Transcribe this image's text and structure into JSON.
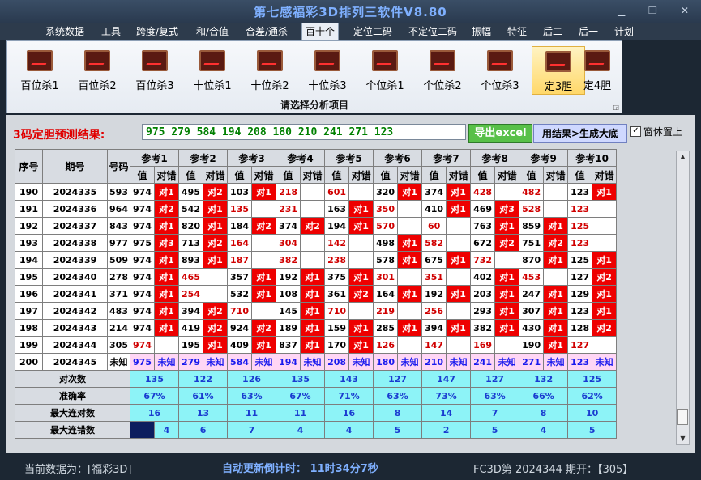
{
  "app": {
    "title": "第七感福彩3D排列三软件V8.80"
  },
  "menu": [
    "系统数据",
    "工具",
    "跨度/复式",
    "和/合值",
    "合差/通杀",
    "百十个",
    "定位二码",
    "不定位二码",
    "振幅",
    "特征",
    "后二",
    "后一",
    "计划"
  ],
  "menu_active": 5,
  "ribbon": {
    "buttons": [
      "百位杀1",
      "百位杀2",
      "百位杀3",
      "十位杀1",
      "十位杀2",
      "十位杀3",
      "个位杀1",
      "个位杀2",
      "个位杀3",
      "定3胆",
      "定4胆"
    ],
    "selected": 9,
    "caption": "请选择分析项目"
  },
  "result": {
    "label": "3码定胆预测结果:",
    "value": "975 279 584 194 208 180 210 241 271 123",
    "export_label": "导出excel",
    "generate_label": "用结果>生成大底",
    "checkbox_label": "窗体置上"
  },
  "table": {
    "headers": {
      "seq": "序号",
      "period": "期号",
      "code": "号码",
      "value": "值",
      "result": "对错"
    },
    "refs": [
      "参考1",
      "参考2",
      "参考3",
      "参考4",
      "参考5",
      "参考6",
      "参考7",
      "参考8",
      "参考9",
      "参考10"
    ],
    "rows": [
      {
        "seq": "190",
        "period": "2024335",
        "code": "593",
        "cells": [
          [
            "974",
            "对1"
          ],
          [
            "495",
            "对2"
          ],
          [
            "103",
            "对1"
          ],
          [
            "218",
            ""
          ],
          [
            "601",
            ""
          ],
          [
            "320",
            "对1"
          ],
          [
            "374",
            "对1"
          ],
          [
            "428",
            ""
          ],
          [
            "482",
            ""
          ],
          [
            "123",
            "对1"
          ]
        ]
      },
      {
        "seq": "191",
        "period": "2024336",
        "code": "964",
        "cells": [
          [
            "974",
            "对2"
          ],
          [
            "542",
            "对1"
          ],
          [
            "135",
            ""
          ],
          [
            "231",
            ""
          ],
          [
            "163",
            "对1"
          ],
          [
            "350",
            ""
          ],
          [
            "410",
            "对1"
          ],
          [
            "469",
            "对3"
          ],
          [
            "528",
            ""
          ],
          [
            "123",
            ""
          ]
        ]
      },
      {
        "seq": "192",
        "period": "2024337",
        "code": "843",
        "cells": [
          [
            "974",
            "对1"
          ],
          [
            "820",
            "对1"
          ],
          [
            "184",
            "对2"
          ],
          [
            "374",
            "对2"
          ],
          [
            "194",
            "对1"
          ],
          [
            "570",
            ""
          ],
          [
            "60",
            ""
          ],
          [
            "763",
            "对1"
          ],
          [
            "859",
            "对1"
          ],
          [
            "125",
            ""
          ]
        ]
      },
      {
        "seq": "193",
        "period": "2024338",
        "code": "977",
        "cells": [
          [
            "975",
            "对3"
          ],
          [
            "713",
            "对2"
          ],
          [
            "164",
            ""
          ],
          [
            "304",
            ""
          ],
          [
            "142",
            ""
          ],
          [
            "498",
            "对1"
          ],
          [
            "582",
            ""
          ],
          [
            "672",
            "对2"
          ],
          [
            "751",
            "对2"
          ],
          [
            "123",
            ""
          ]
        ]
      },
      {
        "seq": "194",
        "period": "2024339",
        "code": "509",
        "cells": [
          [
            "974",
            "对1"
          ],
          [
            "893",
            "对1"
          ],
          [
            "187",
            ""
          ],
          [
            "382",
            ""
          ],
          [
            "238",
            ""
          ],
          [
            "578",
            "对1"
          ],
          [
            "675",
            "对1"
          ],
          [
            "732",
            ""
          ],
          [
            "870",
            "对1"
          ],
          [
            "125",
            "对1"
          ]
        ]
      },
      {
        "seq": "195",
        "period": "2024340",
        "code": "278",
        "cells": [
          [
            "974",
            "对1"
          ],
          [
            "465",
            ""
          ],
          [
            "357",
            "对1"
          ],
          [
            "192",
            "对1"
          ],
          [
            "375",
            "对1"
          ],
          [
            "301",
            ""
          ],
          [
            "351",
            ""
          ],
          [
            "402",
            "对1"
          ],
          [
            "453",
            ""
          ],
          [
            "127",
            "对2"
          ]
        ]
      },
      {
        "seq": "196",
        "period": "2024341",
        "code": "371",
        "cells": [
          [
            "974",
            "对1"
          ],
          [
            "254",
            ""
          ],
          [
            "532",
            "对1"
          ],
          [
            "108",
            "对1"
          ],
          [
            "361",
            "对2"
          ],
          [
            "164",
            "对1"
          ],
          [
            "192",
            "对1"
          ],
          [
            "203",
            "对1"
          ],
          [
            "247",
            "对1"
          ],
          [
            "129",
            "对1"
          ]
        ]
      },
      {
        "seq": "197",
        "period": "2024342",
        "code": "483",
        "cells": [
          [
            "974",
            "对1"
          ],
          [
            "394",
            "对2"
          ],
          [
            "710",
            ""
          ],
          [
            "145",
            "对1"
          ],
          [
            "710",
            ""
          ],
          [
            "219",
            ""
          ],
          [
            "256",
            ""
          ],
          [
            "293",
            "对1"
          ],
          [
            "307",
            "对1"
          ],
          [
            "123",
            "对1"
          ]
        ]
      },
      {
        "seq": "198",
        "period": "2024343",
        "code": "214",
        "cells": [
          [
            "974",
            "对1"
          ],
          [
            "419",
            "对2"
          ],
          [
            "924",
            "对2"
          ],
          [
            "189",
            "对1"
          ],
          [
            "159",
            "对1"
          ],
          [
            "285",
            "对1"
          ],
          [
            "394",
            "对1"
          ],
          [
            "382",
            "对1"
          ],
          [
            "430",
            "对1"
          ],
          [
            "128",
            "对2"
          ]
        ]
      },
      {
        "seq": "199",
        "period": "2024344",
        "code": "305",
        "cells": [
          [
            "974",
            ""
          ],
          [
            "195",
            "对1"
          ],
          [
            "409",
            "对1"
          ],
          [
            "837",
            "对1"
          ],
          [
            "170",
            "对1"
          ],
          [
            "126",
            ""
          ],
          [
            "147",
            ""
          ],
          [
            "169",
            ""
          ],
          [
            "190",
            "对1"
          ],
          [
            "127",
            ""
          ]
        ]
      }
    ],
    "pred_row": {
      "seq": "200",
      "period": "2024345",
      "code": "未知",
      "cells": [
        [
          "975",
          "未知"
        ],
        [
          "279",
          "未知"
        ],
        [
          "584",
          "未知"
        ],
        [
          "194",
          "未知"
        ],
        [
          "208",
          "未知"
        ],
        [
          "180",
          "未知"
        ],
        [
          "210",
          "未知"
        ],
        [
          "241",
          "未知"
        ],
        [
          "271",
          "未知"
        ],
        [
          "123",
          "未知"
        ]
      ]
    },
    "stats": [
      {
        "label": "对次数",
        "values": [
          "135",
          "122",
          "126",
          "135",
          "143",
          "127",
          "147",
          "127",
          "132",
          "125"
        ]
      },
      {
        "label": "准确率",
        "values": [
          "67%",
          "61%",
          "63%",
          "67%",
          "71%",
          "63%",
          "73%",
          "63%",
          "66%",
          "62%"
        ]
      },
      {
        "label": "最大连对数",
        "values": [
          "16",
          "13",
          "11",
          "11",
          "16",
          "8",
          "14",
          "7",
          "8",
          "10"
        ]
      },
      {
        "label": "最大连错数",
        "values": [
          "4",
          "6",
          "7",
          "4",
          "4",
          "5",
          "2",
          "5",
          "4",
          "5"
        ]
      }
    ]
  },
  "status": {
    "current_data": "当前数据为：[福彩3D]",
    "countdown": "自动更新倒计时：  11时34分7秒",
    "period_info": "FC3D第 2024344 期开：【305】"
  }
}
